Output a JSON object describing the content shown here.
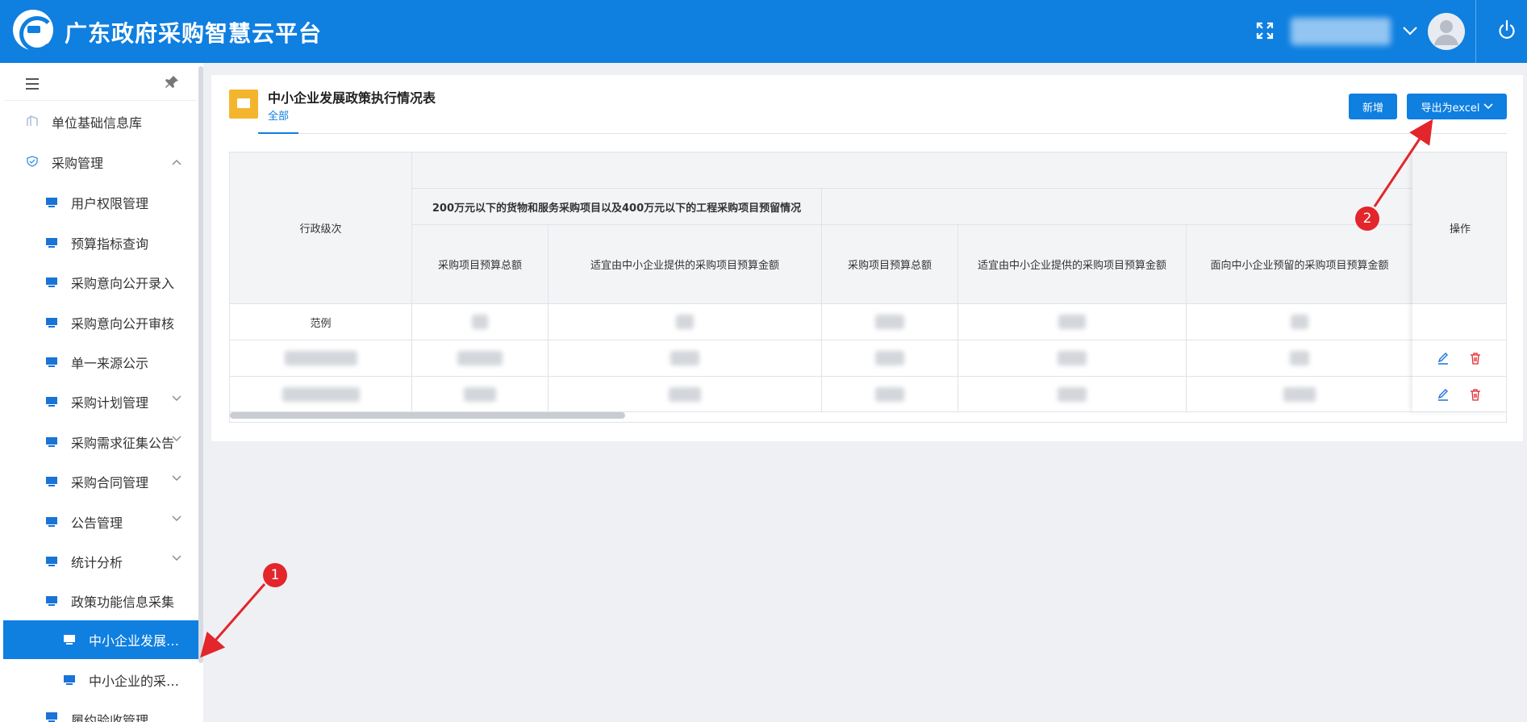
{
  "header": {
    "app_title": "广东政府采购智慧云平台",
    "fullscreen_icon": "fullscreen-icon",
    "user_name": "",
    "power_icon": "power-icon"
  },
  "sidebar": {
    "items": [
      {
        "label": "单位基础信息库",
        "icon": "building-icon"
      },
      {
        "label": "采购管理",
        "icon": "shield-check-icon",
        "expanded": true
      },
      {
        "label": "用户权限管理",
        "icon": "monitor-icon"
      },
      {
        "label": "预算指标查询",
        "icon": "monitor-icon"
      },
      {
        "label": "采购意向公开录入",
        "icon": "monitor-icon"
      },
      {
        "label": "采购意向公开审核",
        "icon": "monitor-icon"
      },
      {
        "label": "单一来源公示",
        "icon": "monitor-icon"
      },
      {
        "label": "采购计划管理",
        "icon": "monitor-icon",
        "expandable": true
      },
      {
        "label": "采购需求征集公告",
        "icon": "monitor-icon",
        "expandable": true
      },
      {
        "label": "采购合同管理",
        "icon": "monitor-icon",
        "expandable": true
      },
      {
        "label": "公告管理",
        "icon": "monitor-icon",
        "expandable": true
      },
      {
        "label": "统计分析",
        "icon": "monitor-icon",
        "expandable": true
      },
      {
        "label": "政策功能信息采集",
        "icon": "monitor-icon",
        "expanded": true
      },
      {
        "label": "中小企业发展…",
        "icon": "monitor-icon",
        "active": true
      },
      {
        "label": "中小企业的采…",
        "icon": "monitor-icon"
      },
      {
        "label": "履约验收管理",
        "icon": "monitor-icon"
      }
    ]
  },
  "page": {
    "title": "中小企业发展政策执行情况表",
    "tab_all": "全部",
    "add_button": "新增",
    "export_button": "导出为excel"
  },
  "table": {
    "header_level": "行政级次",
    "header_group": "200万元以下的货物和服务采购项目以及400万元以下的工程采购项目预留情况",
    "columns": [
      "采购项目预算总额",
      "适宜由中小企业提供的采购项目预算金额",
      "采购项目预算总额",
      "适宜由中小企业提供的采购项目预算金额",
      "面向中小企业预留的采购项目预算金额"
    ],
    "header_ops": "操作",
    "rows": [
      {
        "level": "范例"
      },
      {
        "level": ""
      },
      {
        "level": ""
      }
    ]
  },
  "annotations": [
    {
      "label": "1"
    },
    {
      "label": "2"
    }
  ],
  "colors": {
    "brand": "#0f7fe0",
    "delete": "#e2262b",
    "annotation": "#e2262b",
    "page_icon": "#f4b52e"
  }
}
